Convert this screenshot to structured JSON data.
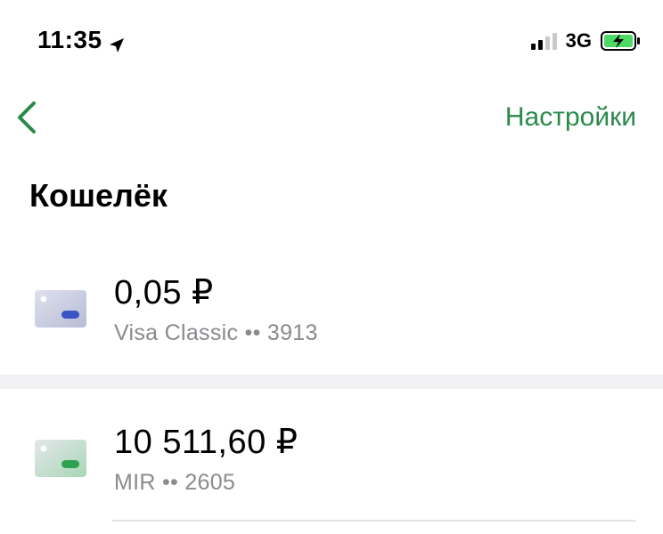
{
  "status_bar": {
    "time": "11:35",
    "network": "3G",
    "location_icon": "location-arrow-icon",
    "signal_icon": "cellular-signal-icon",
    "battery_icon": "battery-charging-icon",
    "battery_color": "#4cd964"
  },
  "nav": {
    "back_icon": "chevron-left-icon",
    "settings_label": "Настройки",
    "accent_color": "#2a8a4a"
  },
  "page": {
    "title": "Кошелёк"
  },
  "cards": [
    {
      "amount": "0,05 ₽",
      "subtitle": "Visa Classic •• 3913",
      "icon": "visa-card-icon",
      "chip_color": "#3a55c4"
    },
    {
      "amount": "10 511,60 ₽",
      "subtitle": "MIR •• 2605",
      "icon": "mir-card-icon",
      "chip_color": "#2fa24f"
    }
  ]
}
